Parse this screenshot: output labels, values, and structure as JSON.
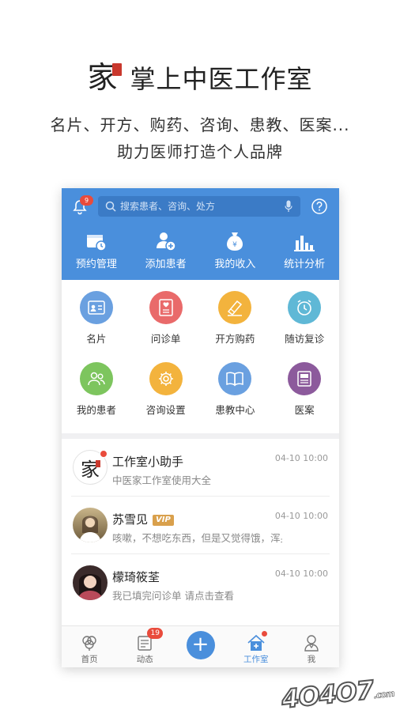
{
  "promo": {
    "logo_glyph": "家",
    "title": "掌上中医工作室",
    "tagline_line1": "名片、开方、购药、咨询、患教、医案...",
    "tagline_line2": "助力医师打造个人品牌"
  },
  "header": {
    "notification_count": "9",
    "search_placeholder": "搜索患者、咨询、处方",
    "quick_actions": [
      {
        "label": "预约管理",
        "icon": "calendar-clock-icon"
      },
      {
        "label": "添加患者",
        "icon": "add-user-icon"
      },
      {
        "label": "我的收入",
        "icon": "money-bag-icon"
      },
      {
        "label": "统计分析",
        "icon": "bar-chart-icon"
      }
    ]
  },
  "features": [
    {
      "label": "名片",
      "icon": "card-icon",
      "color": "#6aa0e0"
    },
    {
      "label": "问诊单",
      "icon": "inquiry-form-icon",
      "color": "#e96a6a"
    },
    {
      "label": "开方购药",
      "icon": "prescription-icon",
      "color": "#f3b33d"
    },
    {
      "label": "随访复诊",
      "icon": "clock-icon",
      "color": "#5fb8d6"
    },
    {
      "label": "我的患者",
      "icon": "patients-icon",
      "color": "#7dc55e"
    },
    {
      "label": "咨询设置",
      "icon": "settings-icon",
      "color": "#f3b33d"
    },
    {
      "label": "患教中心",
      "icon": "book-icon",
      "color": "#6aa0e0"
    },
    {
      "label": "医案",
      "icon": "case-icon",
      "color": "#8c5a9c"
    }
  ],
  "messages": [
    {
      "name": "工作室小助手",
      "text": "中医家工作室使用大全",
      "time": "04-10 10:00"
    },
    {
      "name": "苏雪见",
      "badge": "VIP",
      "text": "咳嗽，不想吃东西，但是又觉得饿，浑身没...",
      "time": "04-10 10:00"
    },
    {
      "name": "檬琦筱荃",
      "text": "我已填完问诊单 请点击查看",
      "time": "04-10 10:00"
    }
  ],
  "tabbar": {
    "tabs": [
      {
        "label": "首页"
      },
      {
        "label": "动态",
        "badge": "19"
      },
      {
        "label": "+"
      },
      {
        "label": "工作室"
      },
      {
        "label": "我"
      }
    ],
    "active_tab": "工作室",
    "accent": "#4a8fdc"
  },
  "watermark": {
    "text": "4O4O7",
    "suffix": ".com"
  }
}
